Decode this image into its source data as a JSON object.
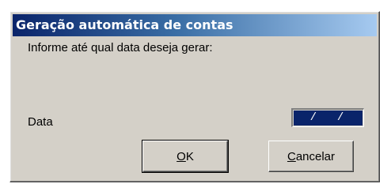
{
  "window": {
    "title": "Geração automática de contas"
  },
  "content": {
    "prompt": "Informe até qual data deseja gerar:",
    "date_label": "Data",
    "date_value": " /  / "
  },
  "buttons": {
    "ok": {
      "mnemonic": "O",
      "rest": "K"
    },
    "cancel": {
      "mnemonic": "C",
      "rest": "ancelar"
    }
  },
  "colors": {
    "dialog_face": "#d4d0c8",
    "titlebar_start": "#0a246a",
    "titlebar_end": "#a6caf0",
    "field_selection": "#0a246a"
  }
}
